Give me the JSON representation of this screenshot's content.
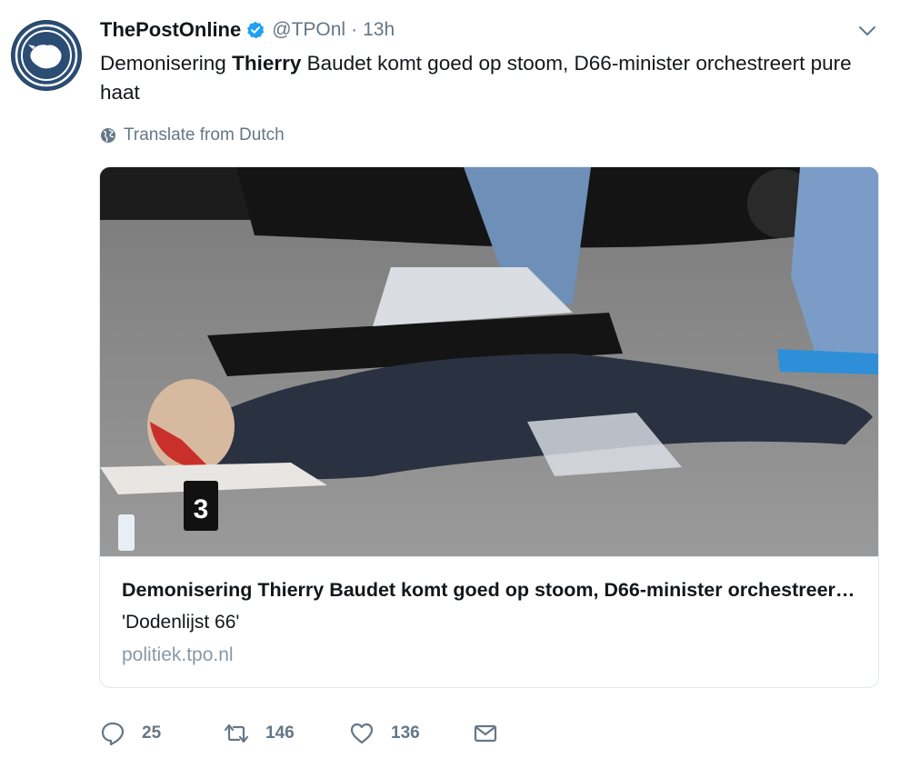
{
  "account": {
    "display_name": "ThePostOnline",
    "handle": "@TPOnl",
    "separator": "·",
    "time": "13h"
  },
  "tweet": {
    "text_before": "Demonisering ",
    "text_bold": "Thierry",
    "text_after": " Baudet komt goed op stoom, D66-minister orchestreert pure haat",
    "translate_label": "Translate from Dutch"
  },
  "card": {
    "title": "Demonisering Thierry Baudet komt goed op stoom, D66-minister orchestreert pure haat",
    "description": "'Dodenlijst 66'",
    "domain": "politiek.tpo.nl",
    "evidence_marker": "3"
  },
  "actions": {
    "reply_count": "25",
    "retweet_count": "146",
    "like_count": "136"
  },
  "icons": {
    "verified": "verified-badge-icon",
    "caret": "chevron-down-icon",
    "globe": "globe-icon",
    "reply": "reply-icon",
    "retweet": "retweet-icon",
    "like": "heart-icon",
    "dm": "envelope-icon"
  },
  "colors": {
    "accent": "#1da1f2",
    "muted": "#657786",
    "text": "#14171a",
    "border": "#e1e8ed"
  }
}
